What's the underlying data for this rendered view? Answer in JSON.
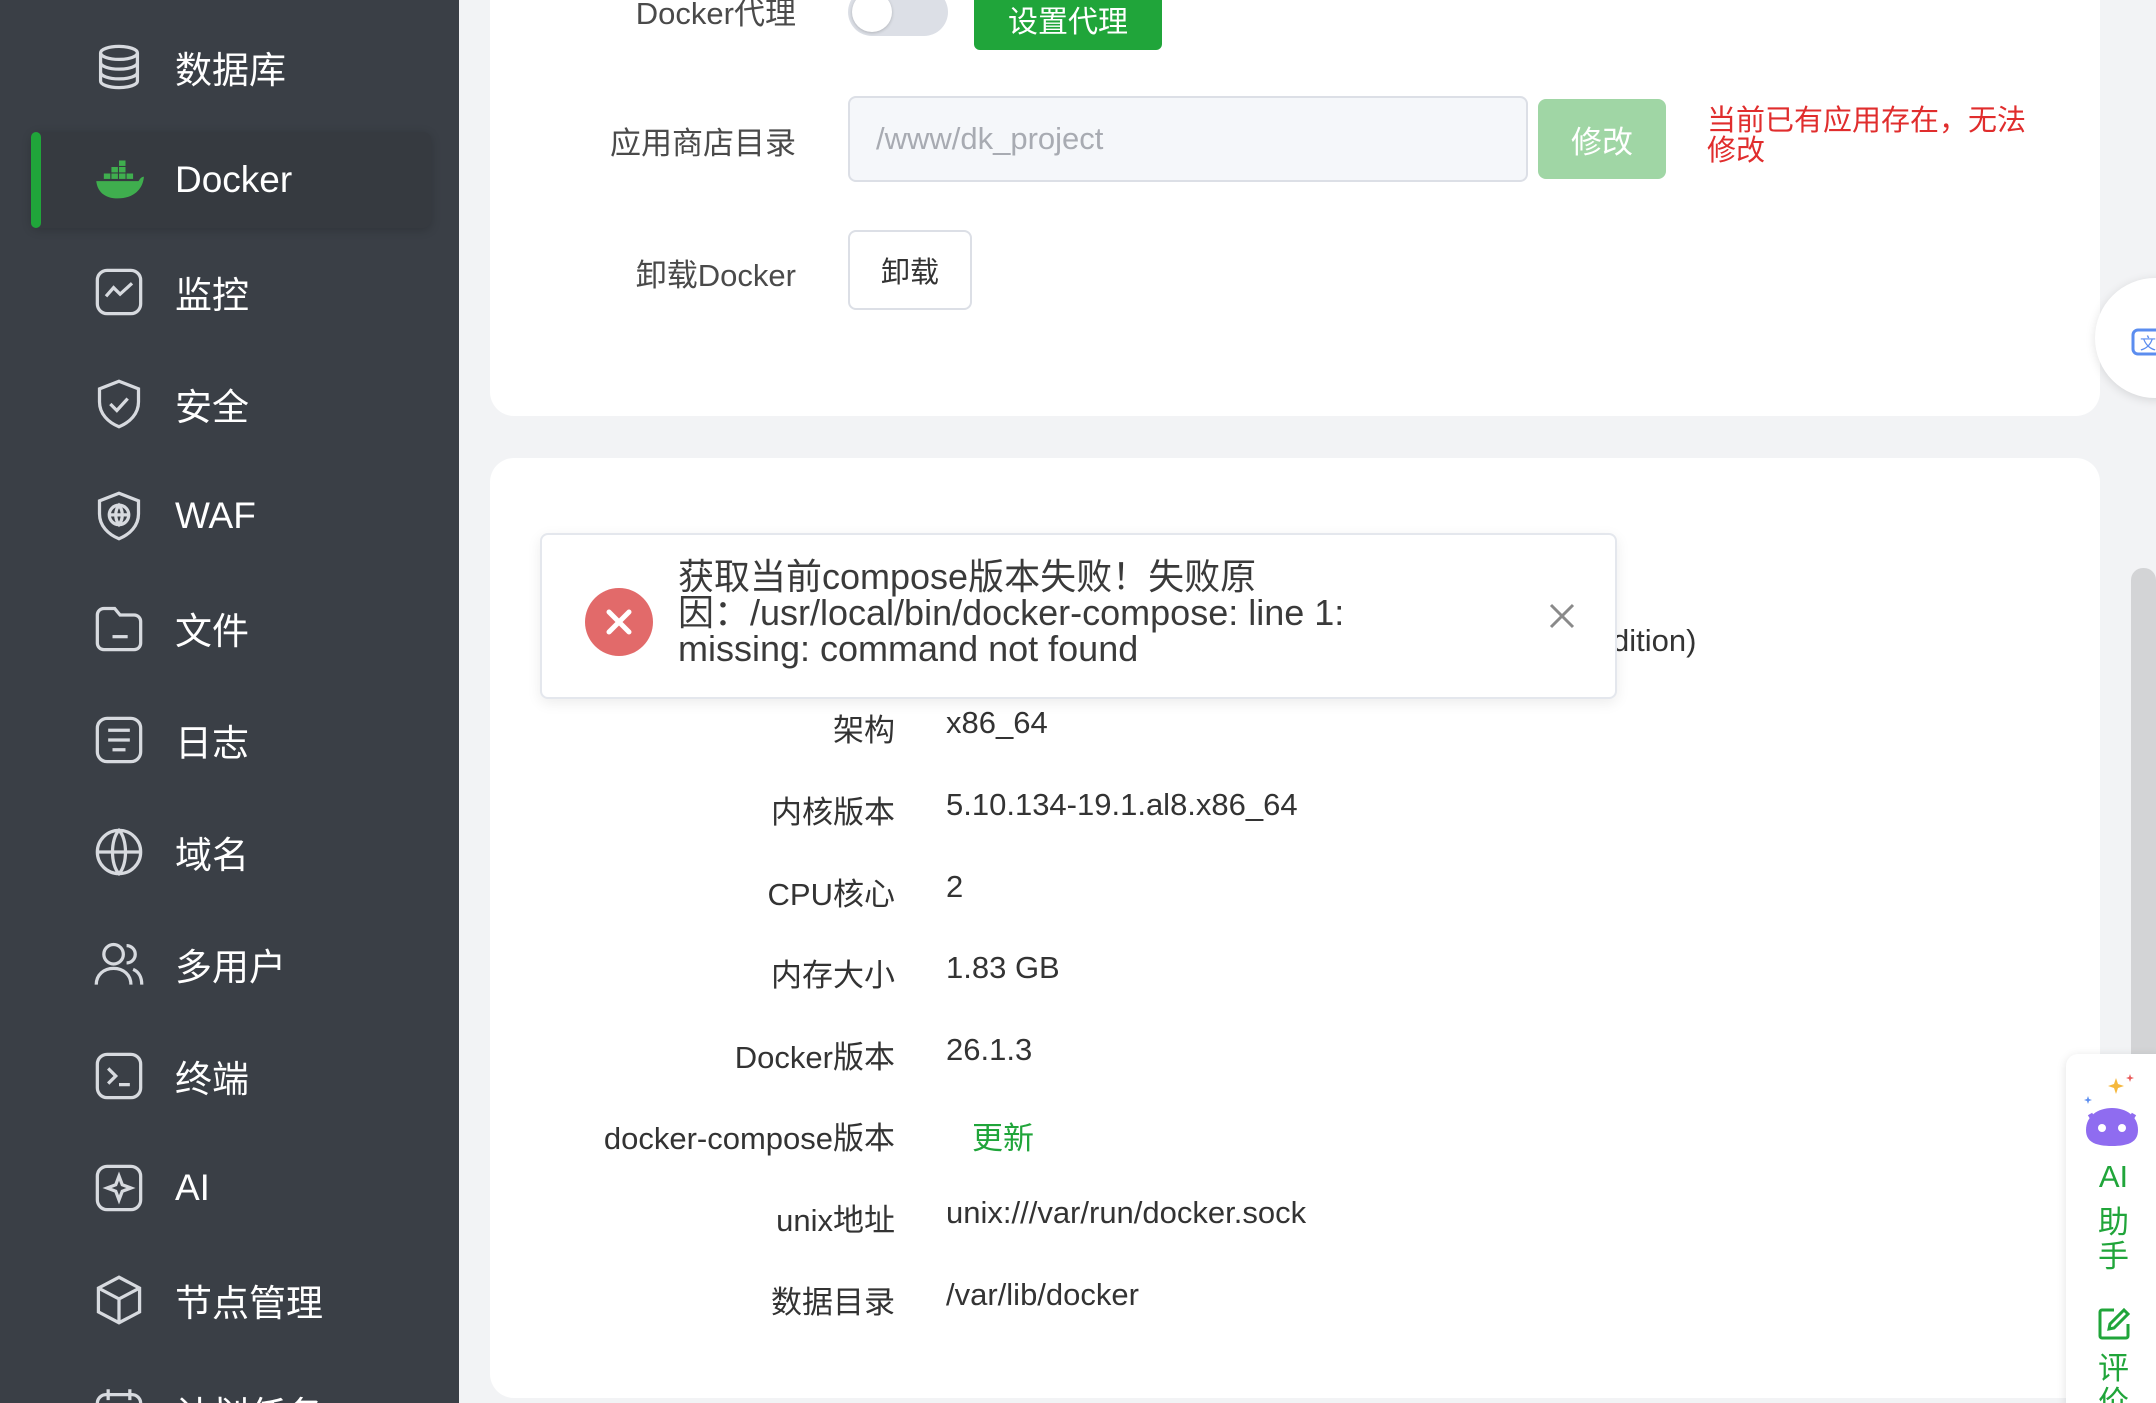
{
  "sidebar": {
    "items": [
      {
        "label": "数据库",
        "icon": "database-icon"
      },
      {
        "label": "Docker",
        "icon": "docker-icon",
        "active": true
      },
      {
        "label": "监控",
        "icon": "monitor-icon"
      },
      {
        "label": "安全",
        "icon": "shield-check-icon"
      },
      {
        "label": "WAF",
        "icon": "waf-shield-icon"
      },
      {
        "label": "文件",
        "icon": "folder-icon"
      },
      {
        "label": "日志",
        "icon": "log-icon"
      },
      {
        "label": "域名",
        "icon": "www-globe-icon"
      },
      {
        "label": "多用户",
        "icon": "users-icon"
      },
      {
        "label": "终端",
        "icon": "terminal-icon"
      },
      {
        "label": "AI",
        "icon": "ai-sparkle-icon"
      },
      {
        "label": "节点管理",
        "icon": "cube-icon"
      },
      {
        "label": "计划任务",
        "icon": "calendar-icon"
      }
    ]
  },
  "settings": {
    "proxy_label": "Docker代理",
    "proxy_button": "设置代理",
    "store_dir_label": "应用商店目录",
    "store_dir_value": "/www/dk_project",
    "modify_button": "修改",
    "modify_warning": "当前已有应用存在，无法修改",
    "uninstall_label": "卸载Docker",
    "uninstall_button": "卸载"
  },
  "info": {
    "partial_text": "dition)",
    "rows": [
      {
        "label": "架构",
        "value": "x86_64"
      },
      {
        "label": "内核版本",
        "value": "5.10.134-19.1.al8.x86_64"
      },
      {
        "label": "CPU核心",
        "value": "2"
      },
      {
        "label": "内存大小",
        "value": "1.83 GB"
      },
      {
        "label": "Docker版本",
        "value": "26.1.3"
      },
      {
        "label": "docker-compose版本",
        "value": "更新"
      },
      {
        "label": "unix地址",
        "value": "unix:///var/run/docker.sock"
      },
      {
        "label": "数据目录",
        "value": "/var/lib/docker"
      }
    ]
  },
  "toast": {
    "message": "获取当前compose版本失败！失败原因：/usr/local/bin/docker-compose: line 1: missing: command not found"
  },
  "ai_panel": {
    "ai_label": "AI",
    "assistant_label_1": "助",
    "assistant_label_2": "手",
    "review_label_1": "评",
    "review_label_2": "价"
  },
  "colors": {
    "accent": "#20a53a",
    "sidebar_bg": "#3a3f46",
    "error": "#e02d2d",
    "error_icon": "#e26a6a"
  }
}
